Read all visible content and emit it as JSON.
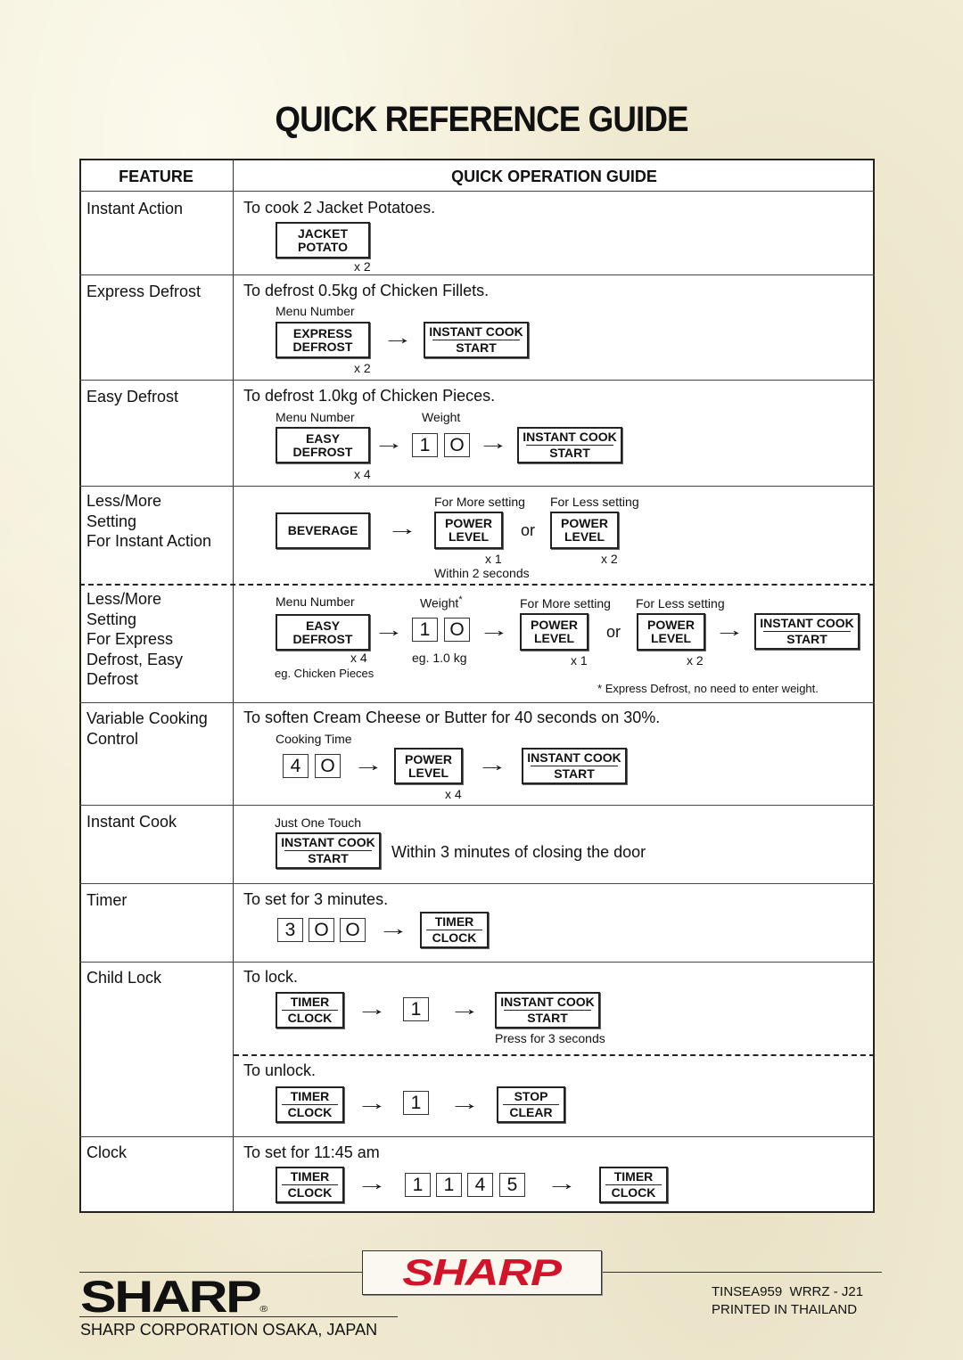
{
  "title": "QUICK REFERENCE GUIDE",
  "table": {
    "headers": {
      "feature": "FEATURE",
      "guide": "QUICK OPERATION GUIDE"
    },
    "rows": {
      "instant_action": {
        "feature": "Instant Action",
        "desc": "To cook 2 Jacket Potatoes.",
        "key1": [
          "JACKET",
          "POTATO"
        ],
        "mult": "x 2"
      },
      "express_defrost": {
        "feature": "Express Defrost",
        "desc": "To defrost 0.5kg of Chicken Fillets.",
        "label": "Menu Number",
        "key1": [
          "EXPRESS",
          "DEFROST"
        ],
        "mult": "x 2",
        "key2": [
          "INSTANT COOK",
          "START"
        ]
      },
      "easy_defrost": {
        "feature": "Easy Defrost",
        "desc": "To defrost 1.0kg of Chicken Pieces.",
        "label1": "Menu Number",
        "label2": "Weight",
        "key1": [
          "EASY",
          "DEFROST"
        ],
        "mult": "x 4",
        "digits": [
          "1",
          "O"
        ],
        "key2": [
          "INSTANT COOK",
          "START"
        ]
      },
      "less_more_instant": {
        "feature": [
          "Less/More",
          "Setting",
          "For Instant Action"
        ],
        "key1": "BEVERAGE",
        "label_more": "For More setting",
        "label_less": "For Less setting",
        "key2": [
          "POWER",
          "LEVEL"
        ],
        "or": "or",
        "key3": [
          "POWER",
          "LEVEL"
        ],
        "mult_more": "x 1",
        "mult_less": "x 2",
        "note": "Within 2 seconds"
      },
      "less_more_defrost": {
        "feature": [
          "Less/More",
          "Setting",
          "For Express",
          "Defrost, Easy",
          "Defrost"
        ],
        "label1": "Menu Number",
        "label2": "Weight",
        "asterisk": "*",
        "label_more": "For More setting",
        "label_less": "For Less setting",
        "key1": [
          "EASY",
          "DEFROST"
        ],
        "digits": [
          "1",
          "O"
        ],
        "key2": [
          "POWER",
          "LEVEL"
        ],
        "or": "or",
        "key3": [
          "POWER",
          "LEVEL"
        ],
        "key4": [
          "INSTANT COOK",
          "START"
        ],
        "mult1": "x 4",
        "example_weight": "eg. 1.0 kg",
        "mult_more": "x 1",
        "mult_less": "x 2",
        "example_menu": "eg. Chicken Pieces",
        "footnote": "Express Defrost, no need to enter weight."
      },
      "variable_cooking": {
        "feature": [
          "Variable Cooking",
          "Control"
        ],
        "desc": "To soften Cream Cheese or Butter for 40 seconds on 30%.",
        "label": "Cooking Time",
        "digits": [
          "4",
          "O"
        ],
        "key1": [
          "POWER",
          "LEVEL"
        ],
        "mult": "x 4",
        "key2": [
          "INSTANT COOK",
          "START"
        ]
      },
      "instant_cook": {
        "feature": "Instant Cook",
        "label": "Just One Touch",
        "key1": [
          "INSTANT COOK",
          "START"
        ],
        "note": "Within 3 minutes of closing the door"
      },
      "timer": {
        "feature": "Timer",
        "desc": "To set for 3 minutes.",
        "digits": [
          "3",
          "O",
          "O"
        ],
        "key1": [
          "TIMER",
          "CLOCK"
        ]
      },
      "child_lock": {
        "feature": "Child Lock",
        "lock_desc": "To lock.",
        "lock_key1": [
          "TIMER",
          "CLOCK"
        ],
        "lock_digit": "1",
        "lock_key2": [
          "INSTANT COOK",
          "START"
        ],
        "lock_note": "Press for 3 seconds",
        "unlock_desc": "To unlock.",
        "unlock_key1": [
          "TIMER",
          "CLOCK"
        ],
        "unlock_digit": "1",
        "unlock_key2": [
          "STOP",
          "CLEAR"
        ]
      },
      "clock": {
        "feature": "Clock",
        "desc": "To set for 11:45 am",
        "key1": [
          "TIMER",
          "CLOCK"
        ],
        "digits": [
          "1",
          "1",
          "4",
          "5"
        ],
        "key2": [
          "TIMER",
          "CLOCK"
        ]
      }
    }
  },
  "footer": {
    "logo_black": "SHARP",
    "registered": "®",
    "logo_red": "SHARP",
    "company": "SHARP CORPORATION OSAKA, JAPAN",
    "code": "TINSEA959  WRRZ - J21",
    "printed": "PRINTED IN THAILAND",
    "brand_red": "#d2142a"
  }
}
